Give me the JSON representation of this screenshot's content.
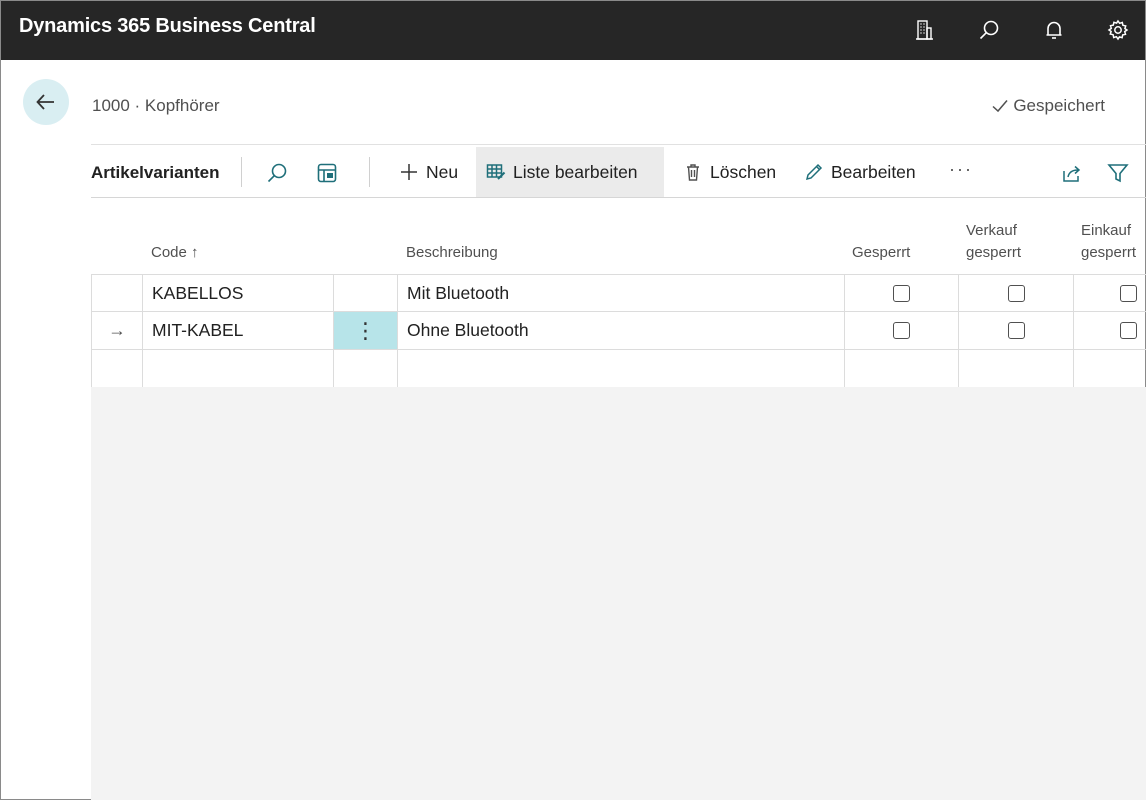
{
  "app": {
    "title": "Dynamics 365 Business Central"
  },
  "topbar_icons": [
    "company-icon",
    "search-icon",
    "bell-icon",
    "gear-icon"
  ],
  "page": {
    "breadcrumb": "1000 · Kopfhörer",
    "saved_status": "Gespeichert"
  },
  "actionbar": {
    "title": "Artikelvarianten",
    "new_label": "Neu",
    "edit_list_label": "Liste bearbeiten",
    "delete_label": "Löschen",
    "edit_label": "Bearbeiten",
    "more_label": "···"
  },
  "table": {
    "headers": {
      "code": "Code ↑",
      "description": "Beschreibung",
      "blocked": "Gesperrt",
      "sales_blocked_1": "Verkauf",
      "sales_blocked_2": "gesperrt",
      "purchase_blocked_1": "Einkauf",
      "purchase_blocked_2": "gesperrt"
    },
    "rows": [
      {
        "indicator": "",
        "code": "KABELLOS",
        "description": "Mit Bluetooth",
        "blocked": false,
        "sales_blocked": false,
        "purchase_blocked": false
      },
      {
        "indicator": "→",
        "code": "MIT-KABEL",
        "description": "Ohne Bluetooth",
        "blocked": false,
        "sales_blocked": false,
        "purchase_blocked": false,
        "menu": "⋮"
      },
      {
        "indicator": "",
        "code": "",
        "description": ""
      }
    ]
  },
  "colors": {
    "topbar": "#262626",
    "accent": "#b7e4e9",
    "back_button": "#d9eef2"
  }
}
